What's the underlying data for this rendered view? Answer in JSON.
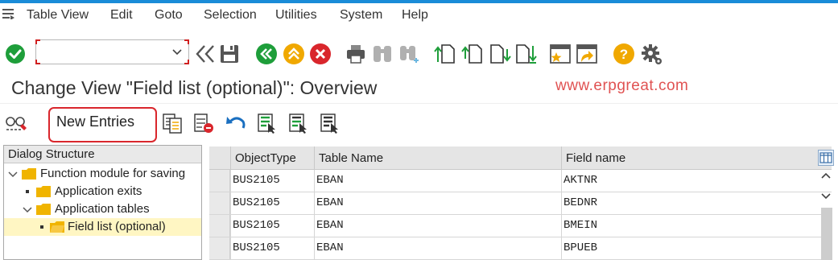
{
  "menubar": {
    "icon": "menu-icon",
    "items": [
      {
        "label": "Table View"
      },
      {
        "label": "Edit"
      },
      {
        "label": "Goto"
      },
      {
        "label": "Selection"
      },
      {
        "label": "Utilities"
      },
      {
        "label": "System"
      },
      {
        "label": "Help"
      }
    ]
  },
  "toolbar": {
    "command_value": "",
    "icons": [
      "enter-icon",
      "back-double-chevron-icon",
      "save-icon",
      "back-icon",
      "exit-icon",
      "cancel-icon",
      "print-icon",
      "find-icon",
      "find-next-icon",
      "first-page-icon",
      "previous-page-icon",
      "next-page-icon",
      "last-page-icon",
      "create-session-icon",
      "shortcut-icon",
      "help-icon",
      "settings-icon"
    ]
  },
  "screen": {
    "title": "Change View \"Field list (optional)\": Overview",
    "watermark": "www.erpgreat.com"
  },
  "app_toolbar": {
    "new_entries_label": "New Entries",
    "icons": [
      "display-change-icon",
      "copy-as-icon",
      "delete-icon",
      "undo-icon",
      "select-all-icon",
      "select-block-icon",
      "deselect-all-icon"
    ]
  },
  "dialog_structure": {
    "header": "Dialog Structure",
    "nodes": [
      {
        "label": "Function module for saving",
        "level": 0,
        "expanded": true
      },
      {
        "label": "Application exits",
        "level": 1,
        "expanded": false
      },
      {
        "label": "Application tables",
        "level": 1,
        "expanded": true
      },
      {
        "label": "Field list (optional)",
        "level": 2,
        "expanded": false,
        "selected": true
      }
    ]
  },
  "table": {
    "columns": [
      "ObjectType",
      "Table Name",
      "Field name"
    ],
    "rows": [
      [
        "BUS2105",
        "EBAN",
        "AKTNR"
      ],
      [
        "BUS2105",
        "EBAN",
        "BEDNR"
      ],
      [
        "BUS2105",
        "EBAN",
        "BMEIN"
      ],
      [
        "BUS2105",
        "EBAN",
        "BPUEB"
      ]
    ]
  },
  "colors": {
    "accent_blue": "#1a8cd8",
    "enter_green": "#1e9e3a",
    "highlight_red": "#d9262c",
    "selected_node": "#fff6c3",
    "folder_yellow": "#f0b400"
  }
}
